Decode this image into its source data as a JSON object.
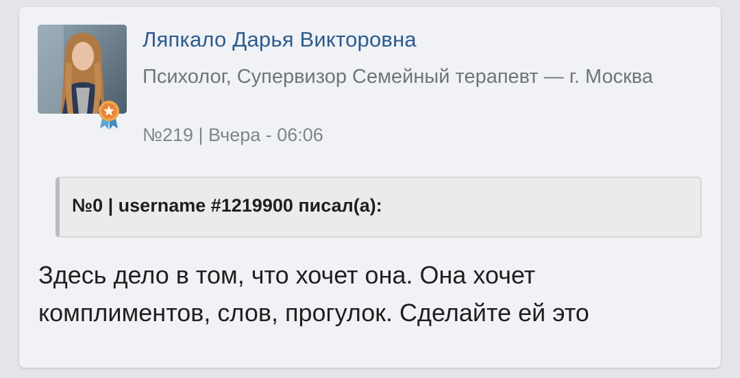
{
  "author": {
    "name": "Ляпкало Дарья Викторовна",
    "role": "Психолог, Супервизор Семейный терапевт — г. Москва",
    "avatar_icon": "user-photo",
    "badge_icon": "award-ribbon-icon"
  },
  "post": {
    "meta": "№219 | Вчера - 06:06",
    "quote_header": "№0 | username #1219900 писал(а):",
    "body": "Здесь дело в том, что хочет она. Она хочет комплиментов, слов, прогулок. Сделайте ей это"
  },
  "colors": {
    "name": "#2c5a8e",
    "card_bg": "#f0f2f5",
    "quote_bg": "#ebebeb",
    "badge_orange": "#e8833a",
    "badge_blue": "#5aa6d6"
  }
}
